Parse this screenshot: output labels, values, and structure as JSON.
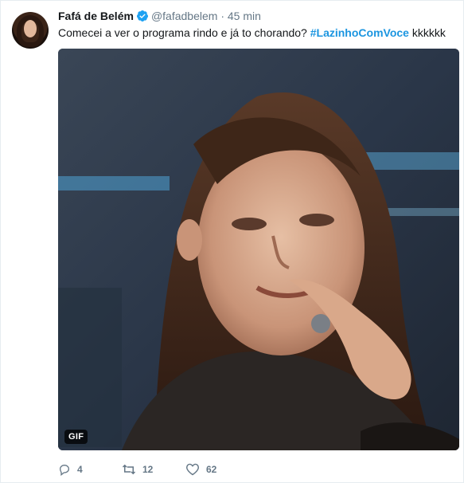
{
  "tweet": {
    "author_name": "Fafá de Belém",
    "handle": "@fafadbelem",
    "separator": "·",
    "time": "45 min",
    "text_before": "Comecei a ver o programa rindo e já to chorando? ",
    "hashtag": "#LazinhoComVoce",
    "text_after": " kkkkkk",
    "media_badge": "GIF",
    "replies": "4",
    "retweets": "12",
    "likes": "62"
  },
  "icons": {
    "verified": "verified-badge-icon",
    "reply": "reply-icon",
    "retweet": "retweet-icon",
    "like": "heart-icon"
  },
  "colors": {
    "accent": "#1b95e0",
    "secondary_text": "#657786",
    "primary_text": "#14171a"
  }
}
